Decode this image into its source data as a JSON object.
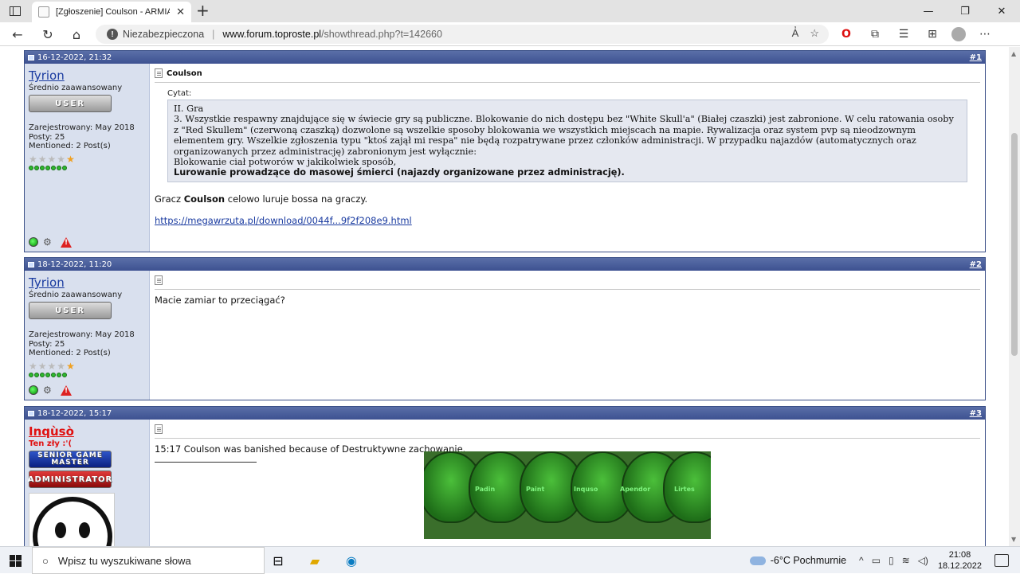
{
  "browser": {
    "tab_title": "[Zgłoszenie] Coulson - ARMIA Po",
    "insecure_label": "Niezabezpieczona",
    "url_host": "www.forum.toproste.pl",
    "url_path": "/showthread.php?t=142660"
  },
  "posts": [
    {
      "date": "16-12-2022, 21:32",
      "number": "#1",
      "username": "Tyrion",
      "usertitle": "Średnio zaawansowany",
      "badge": "USER",
      "registered": "Zarejestrowany: May 2018",
      "posts": "Posty: 25",
      "mentioned": "Mentioned: 2 Post(s)",
      "title": "Coulson",
      "quote_label": "Cytat:",
      "quote_line1": "II. Gra",
      "quote_line2": "3. Wszystkie respawny znajdujące się w świecie gry są publiczne. Blokowanie do nich dostępu bez \"White Skull'a\" (Białej czaszki) jest zabronione. W celu ratowania osoby z \"Red Skullem\" (czerwoną czaszką) dozwolone są wszelkie sposoby blokowania we wszystkich miejscach na mapie. Rywalizacja oraz system pvp są nieodzownym elementem gry. Wszelkie zgłoszenia typu \"ktoś zajął mi respa\" nie będą rozpatrywane przez członków administracji. W przypadku najazdów (automatycznych oraz organizowanych przez administrację) zabronionym jest wyłącznie:",
      "quote_line3": "Blokowanie ciał potworów w jakikolwiek sposób,",
      "quote_bold": "Lurowanie prowadzące do masowej śmierci (najazdy organizowane przez administrację).",
      "text_before": "Gracz ",
      "text_bold": "Coulson",
      "text_after": " celowo luruje bossa na graczy.",
      "link": "https://megawrzuta.pl/download/0044f...9f2f208e9.html"
    },
    {
      "date": "18-12-2022, 11:20",
      "number": "#2",
      "username": "Tyrion",
      "usertitle": "Średnio zaawansowany",
      "badge": "USER",
      "registered": "Zarejestrowany: May 2018",
      "posts": "Posty: 25",
      "mentioned": "Mentioned: 2 Post(s)",
      "text": "Macie zamiar to przeciągać?"
    },
    {
      "date": "18-12-2022, 15:17",
      "number": "#3",
      "username": "Inqùsò",
      "usertitle": "Ten zły :'(",
      "badge1": "SENIOR GAME MASTER",
      "badge2": "ADMINISTRATOR",
      "text": "15:17 Coulson was banished because of Destruktywne zachowanie.",
      "image_names": [
        "Padin",
        "Paint",
        "Inquso",
        "Apendor",
        "Lirtes"
      ]
    }
  ],
  "taskbar": {
    "search_placeholder": "Wpisz tu wyszukiwane słowa",
    "weather": "-6°C  Pochmurnie",
    "time": "21:08",
    "date": "18.12.2022"
  },
  "colors": {
    "post_header": "#3d5191",
    "userbox_bg": "#d9e0ee",
    "link": "#1a3ba0",
    "admin_red": "#e01010"
  }
}
